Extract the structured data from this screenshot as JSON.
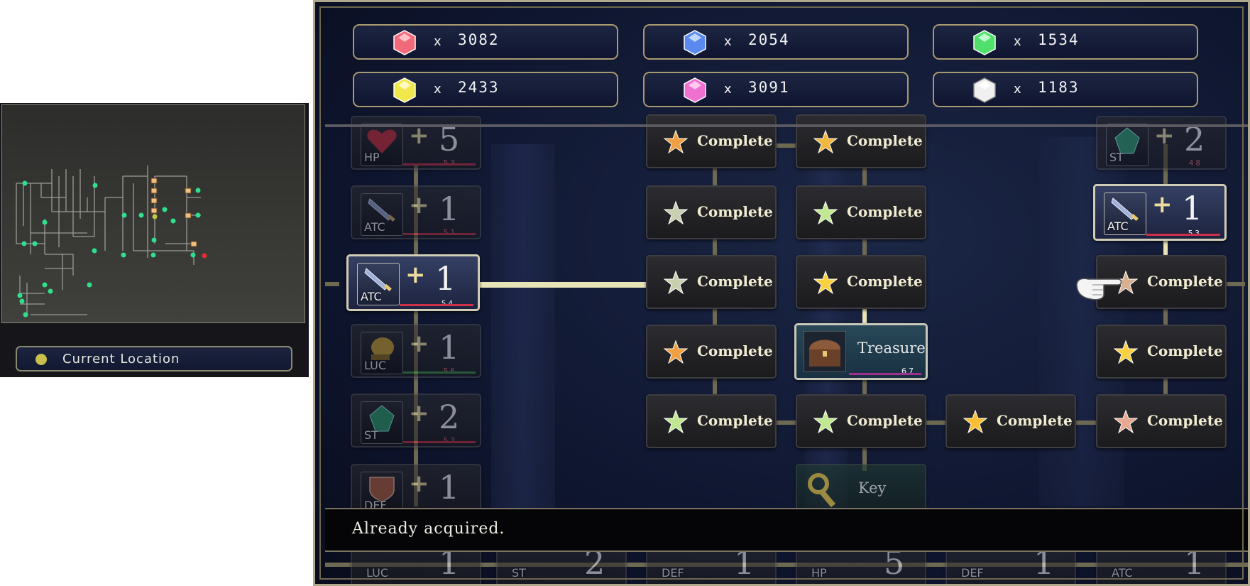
{
  "minimap": {
    "legend_label": "Current Location",
    "colors": {
      "node": "#2ee08c",
      "current": "#c8c04a",
      "danger": "#e03030",
      "wall": "#a0a0a0"
    }
  },
  "gems": [
    {
      "color": "#f06a7a",
      "count": "3082"
    },
    {
      "color": "#5a8af0",
      "count": "2054"
    },
    {
      "color": "#4ee06a",
      "count": "1534"
    },
    {
      "color": "#f0e84a",
      "count": "2433"
    },
    {
      "color": "#f070d0",
      "count": "3091"
    },
    {
      "color": "#f0f0f0",
      "count": "1183"
    }
  ],
  "gem_multiplier": "x",
  "complete_label": "Complete",
  "stat_tiles": [
    {
      "abbr": "HP",
      "plus": "+",
      "value": "5",
      "sub": "53",
      "icon": "heart-icon"
    },
    {
      "abbr": "ATC",
      "plus": "+",
      "value": "1",
      "sub": "51",
      "icon": "sword-icon"
    },
    {
      "abbr": "ATC",
      "plus": "+",
      "value": "1",
      "sub": "54",
      "icon": "sword-icon",
      "highlight": true
    },
    {
      "abbr": "LUC",
      "plus": "+",
      "value": "1",
      "sub": "56",
      "icon": "horn-icon"
    },
    {
      "abbr": "ST",
      "plus": "+",
      "value": "2",
      "sub": "53",
      "icon": "crystal-icon"
    },
    {
      "abbr": "DEF",
      "plus": "+",
      "value": "1",
      "sub": "",
      "icon": "shield-icon"
    }
  ],
  "right_tiles": [
    {
      "abbr": "ST",
      "plus": "+",
      "value": "2",
      "sub": "48",
      "icon": "crystal-icon"
    },
    {
      "abbr": "ATC",
      "plus": "+",
      "value": "1",
      "sub": "53",
      "icon": "sword-icon",
      "highlight": true
    }
  ],
  "bottom_tiles": [
    {
      "abbr": "LUC",
      "value": "1"
    },
    {
      "abbr": "ST",
      "value": "2"
    },
    {
      "abbr": "DEF",
      "value": "1"
    },
    {
      "abbr": "HP",
      "value": "5"
    },
    {
      "abbr": "DEF",
      "value": "1"
    },
    {
      "abbr": "ATC",
      "value": "1"
    }
  ],
  "treasure": {
    "label": "Treasure",
    "sub": "67"
  },
  "key": {
    "label": "Key"
  },
  "message": "Already acquired."
}
